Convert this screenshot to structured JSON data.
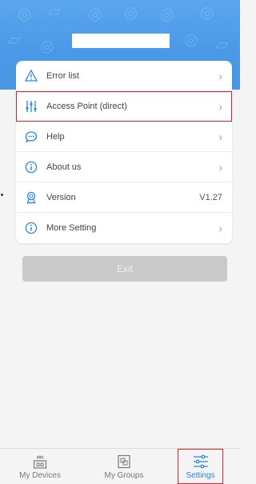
{
  "header": {
    "title": ""
  },
  "settings": {
    "items": [
      {
        "label": "Error list",
        "icon": "warning-icon",
        "trail": "chevron"
      },
      {
        "label": "Access Point (direct)",
        "icon": "sliders-icon",
        "trail": "chevron"
      },
      {
        "label": "Help",
        "icon": "chat-icon",
        "trail": "chevron"
      },
      {
        "label": "About us",
        "icon": "info-icon",
        "trail": "chevron"
      },
      {
        "label": "Version",
        "icon": "badge-icon",
        "trail": "value",
        "value": "V1.27"
      },
      {
        "label": "More Setting",
        "icon": "info-icon",
        "trail": "chevron"
      }
    ],
    "chevron": "›"
  },
  "exit": {
    "label": "Exit"
  },
  "nav": {
    "items": [
      {
        "label": "My Devices",
        "icon": "device-icon"
      },
      {
        "label": "My Groups",
        "icon": "groups-icon"
      },
      {
        "label": "Settings",
        "icon": "settings-sliders-icon",
        "active": true
      }
    ]
  },
  "colors": {
    "accent": "#2a84e0",
    "header": "#4b97e4",
    "highlight": "#e0202a",
    "exit_button": "#c9c9c9"
  }
}
